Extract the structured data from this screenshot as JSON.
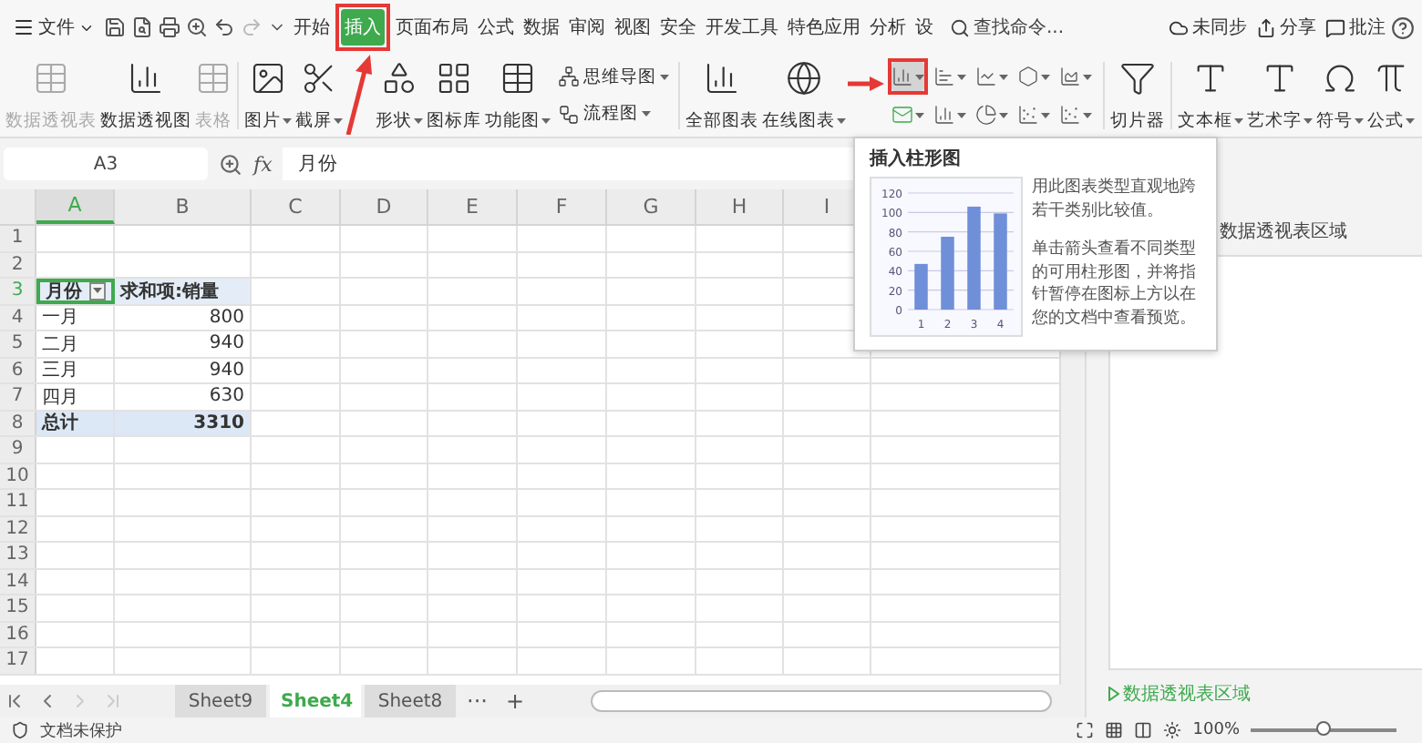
{
  "menu_bar": {
    "file_menu": "文件",
    "tabs": [
      {
        "label": "开始",
        "selected": false,
        "annotated": false
      },
      {
        "label": "插入",
        "selected": true,
        "annotated": true
      },
      {
        "label": "页面布局",
        "selected": false,
        "annotated": false
      },
      {
        "label": "公式",
        "selected": false,
        "annotated": false
      },
      {
        "label": "数据",
        "selected": false,
        "annotated": false
      },
      {
        "label": "审阅",
        "selected": false,
        "annotated": false
      },
      {
        "label": "视图",
        "selected": false,
        "annotated": false
      },
      {
        "label": "安全",
        "selected": false,
        "annotated": false
      },
      {
        "label": "开发工具",
        "selected": false,
        "annotated": false
      },
      {
        "label": "特色应用",
        "selected": false,
        "annotated": false
      },
      {
        "label": "分析",
        "selected": false,
        "annotated": false
      },
      {
        "label": "设",
        "selected": false,
        "annotated": false
      }
    ],
    "search": {
      "placeholder": "查找命令..."
    },
    "actions": [
      "未同步",
      "分享",
      "批注"
    ]
  },
  "ribbon": {
    "left_buttons": [
      {
        "label": "数据透视表",
        "disabled": true
      },
      {
        "label": "数据透视图",
        "disabled": false
      },
      {
        "label": "表格",
        "disabled": true
      }
    ],
    "insert_buttons": [
      {
        "label": "图片",
        "dropdown": true
      },
      {
        "label": "截屏",
        "dropdown": true
      },
      {
        "label": "形状",
        "dropdown": true
      },
      {
        "label": "图标库",
        "dropdown": false
      },
      {
        "label": "功能图",
        "dropdown": true
      }
    ],
    "diagram_buttons": [
      "思维导图",
      "流程图"
    ],
    "chart_buttons": [
      {
        "label": "全部图表",
        "dropdown": false
      },
      {
        "label": "在线图表",
        "dropdown": true
      }
    ],
    "chart_type_buttons": [
      {
        "highlighted": true,
        "annotated": true
      },
      {
        "highlighted": false,
        "annotated": false
      },
      {
        "highlighted": false,
        "annotated": false
      },
      {
        "highlighted": false,
        "annotated": false
      },
      {
        "highlighted": false,
        "annotated": false
      },
      {
        "highlighted": false,
        "annotated": false
      },
      {
        "highlighted": false,
        "annotated": false
      },
      {
        "highlighted": false,
        "annotated": false
      },
      {
        "highlighted": false,
        "annotated": false
      },
      {
        "highlighted": false,
        "annotated": false
      }
    ],
    "slicer_button": "切片器",
    "text_buttons": [
      {
        "label": "文本框",
        "dropdown": true
      },
      {
        "label": "艺术字",
        "dropdown": true
      },
      {
        "label": "符号",
        "dropdown": true
      },
      {
        "label": "公式",
        "dropdown": true
      }
    ]
  },
  "formula_bar": {
    "name_box": "A3",
    "function_label": "fx",
    "value": "月份"
  },
  "grid": {
    "columns": [
      {
        "label": "A",
        "selected": true
      },
      {
        "label": "B",
        "selected": false
      },
      {
        "label": "C",
        "selected": false
      },
      {
        "label": "D",
        "selected": false
      },
      {
        "label": "E",
        "selected": false
      },
      {
        "label": "F",
        "selected": false
      },
      {
        "label": "G",
        "selected": false
      },
      {
        "label": "H",
        "selected": false
      },
      {
        "label": "I",
        "selected": false
      }
    ],
    "rows": [
      {
        "label": "1",
        "selected": false
      },
      {
        "label": "2",
        "selected": false
      },
      {
        "label": "3",
        "selected": true,
        "cells": [
          {
            "text": "月份",
            "kind": "header",
            "selected": true,
            "filter": true
          },
          {
            "text": "求和项:销量",
            "kind": "header",
            "selected": false,
            "filter": false
          }
        ]
      },
      {
        "label": "4",
        "selected": false,
        "cells": [
          {
            "text": "一月",
            "kind": "item",
            "selected": false,
            "filter": false
          },
          {
            "text": "800",
            "kind": "item",
            "selected": false,
            "filter": false
          }
        ]
      },
      {
        "label": "5",
        "selected": false,
        "cells": [
          {
            "text": "二月",
            "kind": "item",
            "selected": false,
            "filter": false
          },
          {
            "text": "940",
            "kind": "item",
            "selected": false,
            "filter": false
          }
        ]
      },
      {
        "label": "6",
        "selected": false,
        "cells": [
          {
            "text": "三月",
            "kind": "item",
            "selected": false,
            "filter": false
          },
          {
            "text": "940",
            "kind": "item",
            "selected": false,
            "filter": false
          }
        ]
      },
      {
        "label": "7",
        "selected": false,
        "cells": [
          {
            "text": "四月",
            "kind": "item",
            "selected": false,
            "filter": false
          },
          {
            "text": "630",
            "kind": "item",
            "selected": false,
            "filter": false
          }
        ]
      },
      {
        "label": "8",
        "selected": false,
        "cells": [
          {
            "text": "总计",
            "kind": "total",
            "selected": false,
            "filter": false
          },
          {
            "text": "3310",
            "kind": "total",
            "selected": false,
            "filter": false
          }
        ]
      },
      {
        "label": "9",
        "selected": false
      },
      {
        "label": "10",
        "selected": false
      },
      {
        "label": "11",
        "selected": false
      },
      {
        "label": "12",
        "selected": false
      },
      {
        "label": "13",
        "selected": false
      },
      {
        "label": "14",
        "selected": false
      },
      {
        "label": "15",
        "selected": false
      },
      {
        "label": "16",
        "selected": false
      },
      {
        "label": "17",
        "selected": false
      }
    ]
  },
  "sheet_tabs": [
    {
      "label": "Sheet9",
      "selected": false
    },
    {
      "label": "Sheet4",
      "selected": true
    },
    {
      "label": "Sheet8",
      "selected": false
    }
  ],
  "sheet_tab_more": "···",
  "sheet_tab_add": "+",
  "side_panel": {
    "area_label": "数据透视表区域",
    "footer_link": "数据透视表区域"
  },
  "status_bar": {
    "protection": "文档未保护",
    "zoom": "100%",
    "zoom_slider": {
      "level": 0.5
    }
  },
  "tooltip": {
    "title": "插入柱形图",
    "paragraphs": [
      "用此图表类型直观地跨若干类别比较值。",
      "单击箭头查看不同类型的可用柱形图，并将指针暂停在图标上方以在您的文档中查看预览。"
    ],
    "chart_data": {
      "type": "bar",
      "categories": [
        "1",
        "2",
        "3",
        "4"
      ],
      "values": [
        47,
        75,
        106,
        99
      ],
      "ylim": [
        0,
        120
      ],
      "yticks": [
        0,
        20,
        40,
        60,
        80,
        100,
        120
      ],
      "grid": true
    }
  }
}
